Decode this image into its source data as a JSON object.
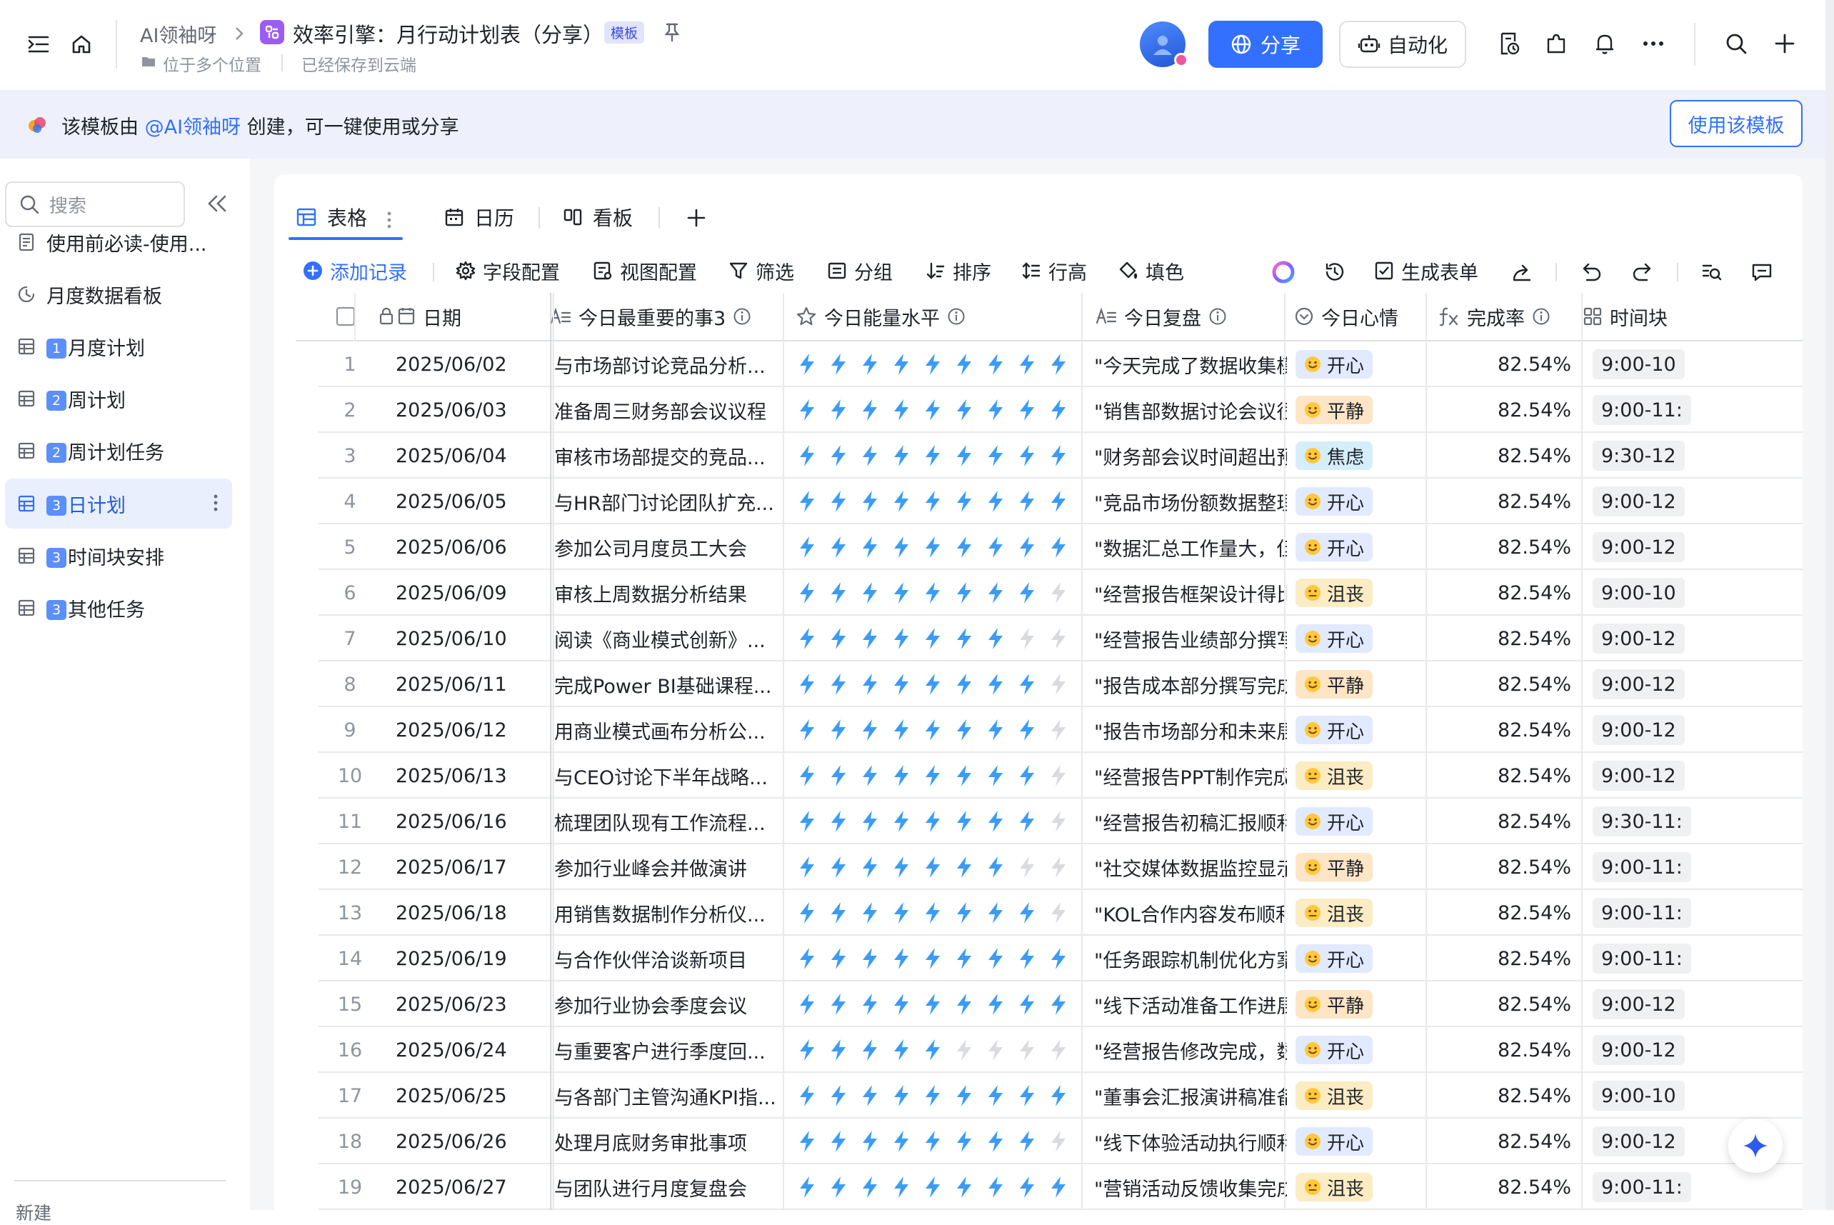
{
  "header": {
    "breadcrumb_root": "AI领袖呀",
    "doc_title": "效率引擎：月行动计划表（分享）",
    "template_badge": "模板",
    "location": "位于多个位置",
    "save_status": "已经保存到云端",
    "share_label": "分享",
    "automation_label": "自动化"
  },
  "banner": {
    "prefix": "该模板由 ",
    "mention": "@AI领袖呀",
    "suffix": " 创建，可一键使用或分享",
    "use_button": "使用该模板"
  },
  "sidebar": {
    "search_placeholder": "搜索",
    "items": [
      {
        "label": "使用前必读-使用...",
        "icon": "doc-icon",
        "badge": ""
      },
      {
        "label": "月度数据看板",
        "icon": "dashboard-icon",
        "badge": ""
      },
      {
        "label": "月度计划",
        "icon": "table-icon",
        "badge": "1"
      },
      {
        "label": "周计划",
        "icon": "table-icon",
        "badge": "2"
      },
      {
        "label": "周计划任务",
        "icon": "table-icon",
        "badge": "2"
      },
      {
        "label": "日计划",
        "icon": "table-icon",
        "badge": "3",
        "active": true
      },
      {
        "label": "时间块安排",
        "icon": "table-icon",
        "badge": "3"
      },
      {
        "label": "其他任务",
        "icon": "table-icon",
        "badge": "3"
      }
    ],
    "new_label": "新建"
  },
  "views": {
    "tabs": [
      "表格",
      "日历",
      "看板"
    ]
  },
  "toolbar": {
    "add_record": "添加记录",
    "field_config": "字段配置",
    "view_config": "视图配置",
    "filter": "筛选",
    "group": "分组",
    "sort": "排序",
    "row_height": "行高",
    "fill": "填色",
    "generate_form": "生成表单"
  },
  "colors": {
    "accent": "#3370ff",
    "bolt_on": "#3b9cf5",
    "bolt_off": "#d9dbde",
    "mood_happy_bg": "#e1eaff",
    "mood_calm_bg": "#fde5c5",
    "mood_anxious_bg": "#d5eefc",
    "mood_down_bg": "#fbecc4"
  },
  "table": {
    "columns": {
      "date": "日期",
      "task3": "今日最重要的事3",
      "energy": "今日能量水平",
      "review": "今日复盘",
      "mood": "今日心情",
      "rate": "完成率",
      "timeblock": "时间块"
    },
    "energy_max": 10,
    "rows": [
      {
        "n": "1",
        "date": "2025/06/02",
        "task3": "与市场部讨论竞品分析...",
        "energy": 10,
        "review": "\"今天完成了数据收集模...",
        "mood": "开心",
        "mood_type": "happy",
        "rate": "82.54%",
        "time": "9:00-10"
      },
      {
        "n": "2",
        "date": "2025/06/03",
        "task3": "准备周三财务部会议议程",
        "energy": 10,
        "review": "\"销售部数据讨论会议很...",
        "mood": "平静",
        "mood_type": "calm",
        "rate": "82.54%",
        "time": "9:00-11:"
      },
      {
        "n": "3",
        "date": "2025/06/04",
        "task3": "审核市场部提交的竞品...",
        "energy": 10,
        "review": "\"财务部会议时间超出预...",
        "mood": "焦虑",
        "mood_type": "anxious",
        "rate": "82.54%",
        "time": "9:30-12"
      },
      {
        "n": "4",
        "date": "2025/06/05",
        "task3": "与HR部门讨论团队扩充...",
        "energy": 10,
        "review": "\"竞品市场份额数据整理...",
        "mood": "开心",
        "mood_type": "happy",
        "rate": "82.54%",
        "time": "9:00-12"
      },
      {
        "n": "5",
        "date": "2025/06/06",
        "task3": "参加公司月度员工大会",
        "energy": 9,
        "review": "\"数据汇总工作量大，但...",
        "mood": "开心",
        "mood_type": "happy",
        "rate": "82.54%",
        "time": "9:00-12"
      },
      {
        "n": "6",
        "date": "2025/06/09",
        "task3": "审核上周数据分析结果",
        "energy": 8,
        "review": "\"经营报告框架设计得比...",
        "mood": "沮丧",
        "mood_type": "down",
        "rate": "82.54%",
        "time": "9:00-10"
      },
      {
        "n": "7",
        "date": "2025/06/10",
        "task3": "阅读《商业模式创新》...",
        "energy": 7,
        "review": "\"经营报告业绩部分撰写...",
        "mood": "开心",
        "mood_type": "happy",
        "rate": "82.54%",
        "time": "9:00-12"
      },
      {
        "n": "8",
        "date": "2025/06/11",
        "task3": "完成Power BI基础课程...",
        "energy": 8,
        "review": "\"报告成本部分撰写完成...",
        "mood": "平静",
        "mood_type": "calm",
        "rate": "82.54%",
        "time": "9:00-12"
      },
      {
        "n": "9",
        "date": "2025/06/12",
        "task3": "用商业模式画布分析公...",
        "energy": 8,
        "review": "\"报告市场部分和未来展...",
        "mood": "开心",
        "mood_type": "happy",
        "rate": "82.54%",
        "time": "9:00-12"
      },
      {
        "n": "10",
        "date": "2025/06/13",
        "task3": "与CEO讨论下半年战略...",
        "energy": 8,
        "review": "\"经营报告PPT制作完成...",
        "mood": "沮丧",
        "mood_type": "down",
        "rate": "82.54%",
        "time": "9:00-12"
      },
      {
        "n": "11",
        "date": "2025/06/16",
        "task3": "梳理团队现有工作流程...",
        "energy": 8,
        "review": "\"经营报告初稿汇报顺利...",
        "mood": "开心",
        "mood_type": "happy",
        "rate": "82.54%",
        "time": "9:30-11:"
      },
      {
        "n": "12",
        "date": "2025/06/17",
        "task3": "参加行业峰会并做演讲",
        "energy": 7,
        "review": "\"社交媒体数据监控显示...",
        "mood": "平静",
        "mood_type": "calm",
        "rate": "82.54%",
        "time": "9:00-11:"
      },
      {
        "n": "13",
        "date": "2025/06/18",
        "task3": "用销售数据制作分析仪...",
        "energy": 8,
        "review": "\"KOL合作内容发布顺利...",
        "mood": "沮丧",
        "mood_type": "down",
        "rate": "82.54%",
        "time": "9:00-11:"
      },
      {
        "n": "14",
        "date": "2025/06/19",
        "task3": "与合作伙伴洽谈新项目",
        "energy": 10,
        "review": "\"任务跟踪机制优化方案...",
        "mood": "开心",
        "mood_type": "happy",
        "rate": "82.54%",
        "time": "9:00-11:"
      },
      {
        "n": "15",
        "date": "2025/06/23",
        "task3": "参加行业协会季度会议",
        "energy": 10,
        "review": "\"线下活动准备工作进展...",
        "mood": "平静",
        "mood_type": "calm",
        "rate": "82.54%",
        "time": "9:00-12"
      },
      {
        "n": "16",
        "date": "2025/06/24",
        "task3": "与重要客户进行季度回...",
        "energy": 5,
        "review": "\"经营报告修改完成，数...",
        "mood": "开心",
        "mood_type": "happy",
        "rate": "82.54%",
        "time": "9:00-12"
      },
      {
        "n": "17",
        "date": "2025/06/25",
        "task3": "与各部门主管沟通KPI指...",
        "energy": 10,
        "review": "\"董事会汇报演讲稿准备...",
        "mood": "沮丧",
        "mood_type": "down",
        "rate": "82.54%",
        "time": "9:00-10"
      },
      {
        "n": "18",
        "date": "2025/06/26",
        "task3": "处理月底财务审批事项",
        "energy": 8,
        "review": "\"线下体验活动执行顺利...",
        "mood": "开心",
        "mood_type": "happy",
        "rate": "82.54%",
        "time": "9:00-12"
      },
      {
        "n": "19",
        "date": "2025/06/27",
        "task3": "与团队进行月度复盘会",
        "energy": 10,
        "review": "\"营销活动反馈收集完成...",
        "mood": "沮丧",
        "mood_type": "down",
        "rate": "82.54%",
        "time": "9:00-11:"
      }
    ]
  }
}
